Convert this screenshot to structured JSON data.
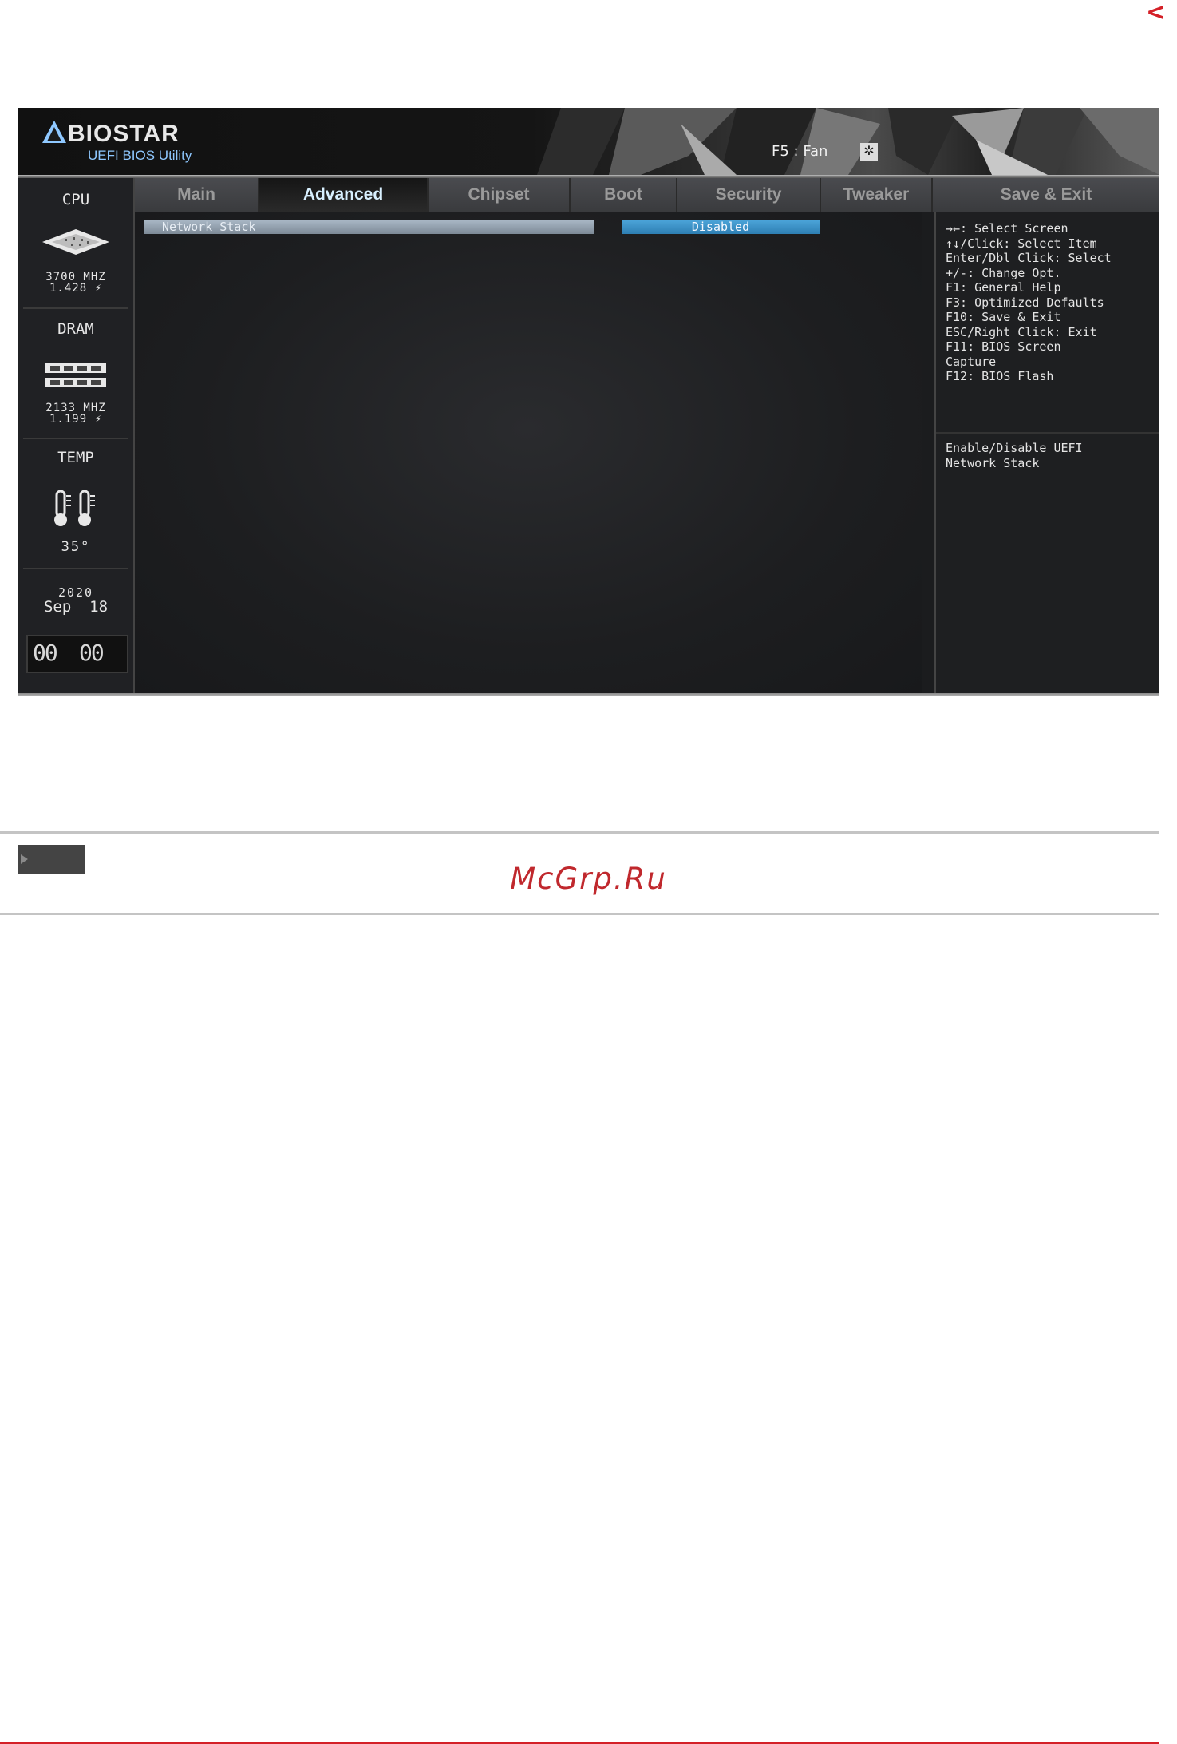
{
  "nav": {
    "back_arrow": "<"
  },
  "header": {
    "brand": "BIOSTAR",
    "subtitle": "UEFI BIOS Utility",
    "fan_hint": "F5 : Fan",
    "fan_icon": "fan-icon"
  },
  "sidebar": {
    "cpu": {
      "label": "CPU",
      "freq": "3700 MHZ",
      "voltage": "1.428 ⚡"
    },
    "dram": {
      "label": "DRAM",
      "freq": "2133 MHZ",
      "voltage": "1.199 ⚡"
    },
    "temp": {
      "label": "TEMP",
      "value": "35°"
    },
    "date": {
      "year": "2020",
      "month_day": "Sep  18"
    },
    "clock": {
      "hours": "00",
      "minutes": "00"
    }
  },
  "tabs": [
    "Main",
    "Advanced",
    "Chipset",
    "Boot",
    "Security",
    "Tweaker",
    "Save & Exit"
  ],
  "active_tab": "Advanced",
  "settings": [
    {
      "label": "Network Stack",
      "value": "Disabled"
    }
  ],
  "help": {
    "keys": "→←: Select Screen\n↑↓/Click: Select Item\nEnter/Dbl Click: Select\n+/-: Change Opt.\nF1: General Help\nF3: Optimized Defaults\nF10: Save & Exit\nESC/Right Click: Exit\nF11: BIOS Screen\nCapture\nF12: BIOS Flash",
    "description": "Enable/Disable UEFI\nNetwork Stack"
  },
  "footer": {
    "watermark": "McGrp.Ru"
  },
  "colors": {
    "accent_red": "#d42027",
    "value_blue": "#2e7fb3",
    "watermark": "#c0282d"
  }
}
